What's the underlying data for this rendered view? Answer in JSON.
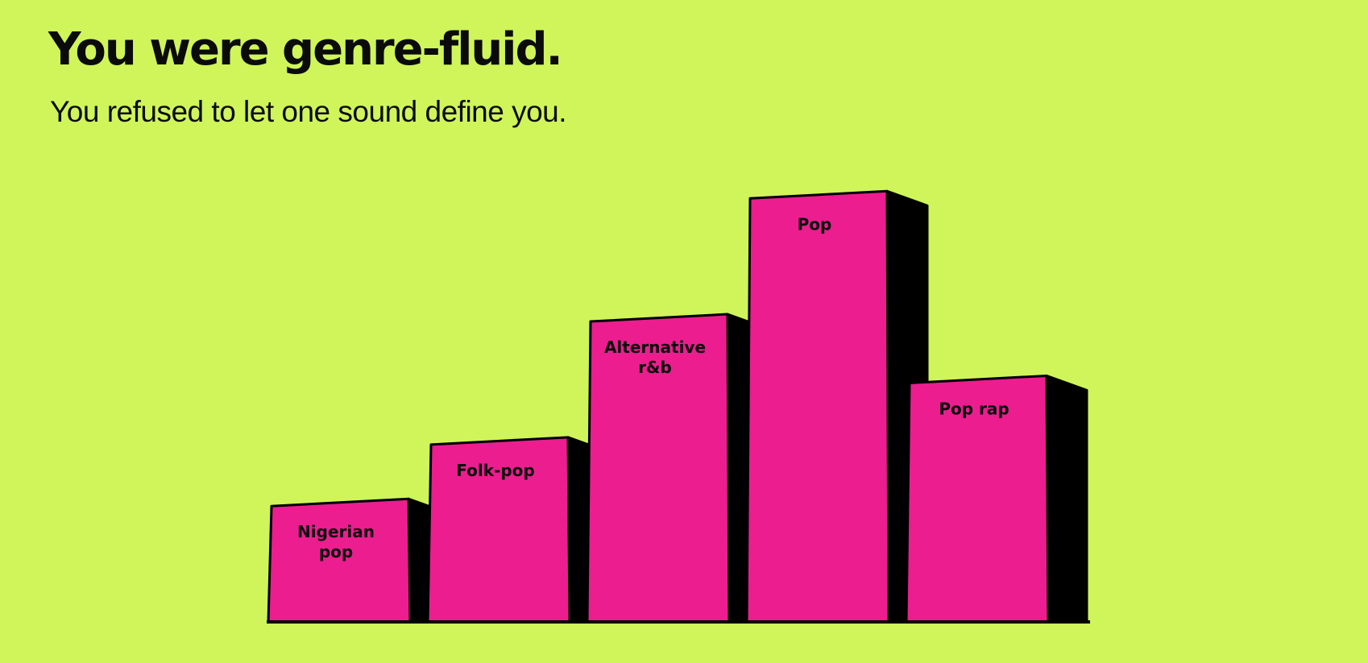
{
  "header": {
    "title": "You were genre-fluid.",
    "subtitle": "You refused to let one sound define you."
  },
  "colors": {
    "background": "#cff55a",
    "bar_face": "#ec1d8f",
    "bar_side": "#000000",
    "text": "#0b0b0b"
  },
  "chart_data": {
    "type": "bar",
    "style": "3d-columns",
    "categories": [
      "Nigerian\npop",
      "Folk-pop",
      "Alternative\nr&b",
      "Pop",
      "Pop rap"
    ],
    "values": [
      2,
      3,
      5,
      7,
      4
    ],
    "ylim": [
      0,
      7.2
    ],
    "grid": false,
    "axes_visible": false
  }
}
